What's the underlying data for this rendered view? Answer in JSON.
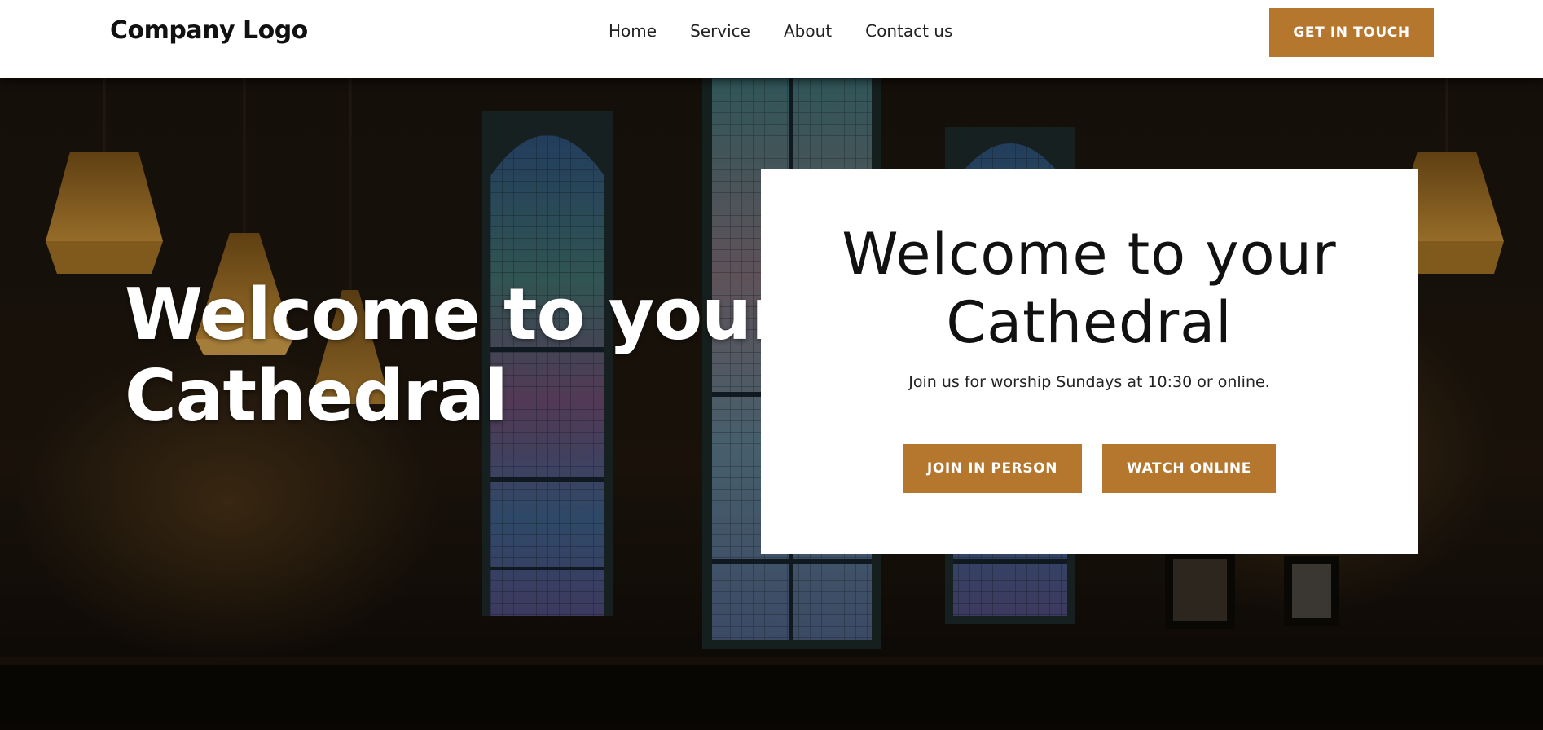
{
  "header": {
    "logo": "Company Logo",
    "nav": [
      "Home",
      "Service",
      "About",
      "Contact us"
    ],
    "cta": "GET IN TOUCH"
  },
  "hero": {
    "title_line1": "Welcome to your",
    "title_line2": "Cathedral"
  },
  "card": {
    "title_line1": "Welcome to your",
    "title_line2": "Cathedral",
    "subtitle": "Join us for worship Sundays at 10:30 or online.",
    "primary_button": "JOIN IN PERSON",
    "secondary_button": "WATCH ONLINE"
  },
  "colors": {
    "accent": "#b5762e",
    "header_bg": "#ffffff",
    "card_bg": "#ffffff"
  }
}
